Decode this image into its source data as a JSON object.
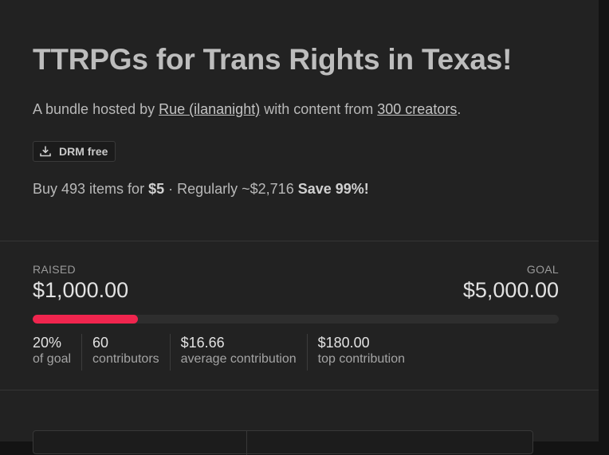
{
  "bundle": {
    "title": "TTRPGs for Trans Rights in Texas!",
    "byline_prefix": "A bundle hosted by ",
    "host_link": "Rue (ilananight)",
    "byline_middle": " with content from ",
    "creators_link": "300 creators",
    "byline_suffix": ".",
    "drm_label": "DRM free",
    "drm_icon": "download-icon",
    "price_prefix": "Buy 493 items for ",
    "price": "$5",
    "price_middle": " · Regularly ~$2,716 ",
    "savings": "Save 99%!"
  },
  "funding": {
    "raised_label": "RAISED",
    "raised_amount": "$1,000.00",
    "goal_label": "GOAL",
    "goal_amount": "$5,000.00",
    "progress_fraction": 0.2,
    "accent_color": "#f0254e",
    "stats": [
      {
        "value": "20%",
        "label": "of goal"
      },
      {
        "value": "60",
        "label": "contributors"
      },
      {
        "value": "$16.66",
        "label": "average contribution"
      },
      {
        "value": "$180.00",
        "label": "top contribution"
      }
    ]
  }
}
